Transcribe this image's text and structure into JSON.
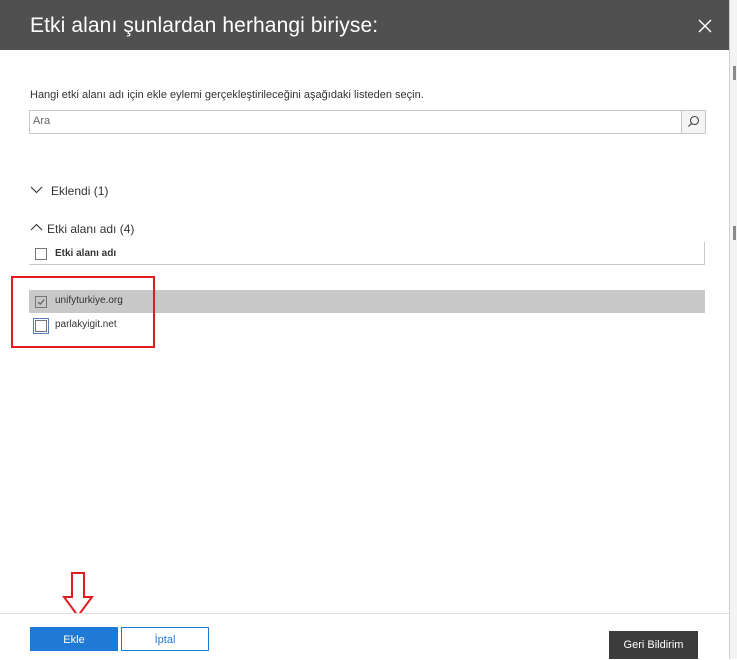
{
  "dialog": {
    "title": "Etki alanı şunlardan herhangi biriyse:",
    "instruction": "Hangi etki alanı adı için ekle eylemi gerçekleştirileceğini aşağıdaki listeden seçin.",
    "search": {
      "placeholder": "Ara",
      "value": ""
    }
  },
  "groups": {
    "added": {
      "label": "Eklendi (1)",
      "expanded": false
    },
    "domains": {
      "label": "Etki alanı adı (4)",
      "expanded": true
    }
  },
  "table": {
    "column_header": "Etki alanı adı",
    "rows": [
      {
        "name": "unifyturkiye.org",
        "checked": true,
        "selected": true
      },
      {
        "name": "parlakyigit.net",
        "checked": false,
        "selected": false
      }
    ]
  },
  "footer": {
    "add_label": "Ekle",
    "cancel_label": "İptal",
    "feedback_label": "Geri Bildirim"
  },
  "colors": {
    "header_bg": "#505050",
    "primary": "#1f7ad6",
    "annotation": "#e11b22",
    "selected_row": "#c8c8c8"
  },
  "icons": {
    "close": "close-icon",
    "search": "search-icon",
    "collapsed": "chevron-down-icon",
    "expanded": "chevron-up-icon",
    "annotation_arrow": "down-arrow-icon"
  }
}
